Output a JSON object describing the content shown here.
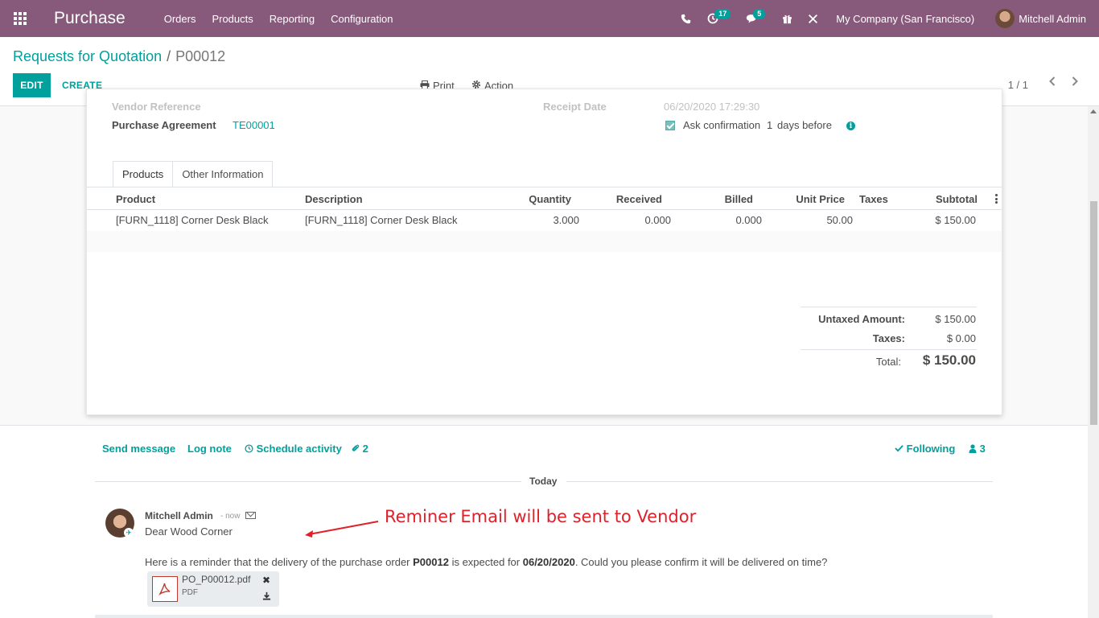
{
  "navbar": {
    "app_name": "Purchase",
    "menu": [
      "Orders",
      "Products",
      "Reporting",
      "Configuration"
    ],
    "activity_count": "17",
    "message_count": "5",
    "company": "My Company (San Francisco)",
    "user": "Mitchell Admin",
    "brand_color": "#875a7b"
  },
  "control": {
    "breadcrumb_parent": "Requests for Quotation",
    "breadcrumb_sep": "/",
    "breadcrumb_current": "P00012",
    "edit_label": "EDIT",
    "create_label": "CREATE",
    "print_label": "Print",
    "action_label": "Action",
    "pager": "1 / 1"
  },
  "form": {
    "vendor_reference_label": "Vendor Reference",
    "receipt_date_label": "Receipt Date",
    "receipt_date_value": "06/20/2020 17:29:30",
    "purchase_agreement_label": "Purchase Agreement",
    "purchase_agreement_value": "TE00001",
    "ask_confirmation_label": "Ask confirmation",
    "ask_confirmation_days": "1",
    "ask_confirmation_suffix": "days before",
    "ask_confirmation_checked": true
  },
  "tabs": [
    "Products",
    "Other Information"
  ],
  "table": {
    "headers": [
      "Product",
      "Description",
      "Quantity",
      "Received",
      "Billed",
      "Unit Price",
      "Taxes",
      "Subtotal"
    ],
    "rows": [
      {
        "product": "[FURN_1118] Corner Desk Black",
        "description": "[FURN_1118] Corner Desk Black",
        "quantity": "3.000",
        "received": "0.000",
        "billed": "0.000",
        "unit_price": "50.00",
        "taxes": "",
        "subtotal": "$ 150.00"
      }
    ]
  },
  "totals": {
    "untaxed_label": "Untaxed Amount:",
    "untaxed_value": "$ 150.00",
    "taxes_label": "Taxes:",
    "taxes_value": "$ 0.00",
    "total_label": "Total:",
    "total_value": "$ 150.00"
  },
  "chatter": {
    "send_message": "Send message",
    "log_note": "Log note",
    "schedule_activity": "Schedule activity",
    "attachments_count": "2",
    "following": "Following",
    "followers_count": "3",
    "day_label": "Today",
    "message": {
      "author": "Mitchell Admin",
      "time": "- now",
      "greeting": "Dear Wood Corner",
      "body_prefix": "Here is a reminder that the delivery of the purchase order ",
      "body_order": "P00012",
      "body_mid": " is expected for ",
      "body_date": "06/20/2020",
      "body_suffix": ". Could you please confirm it will be delivered on time?",
      "attachment_name": "PO_P00012.pdf",
      "attachment_type": "PDF"
    }
  },
  "annotation": {
    "text": "Reminer Email will be sent to Vendor",
    "color": "#e0202a"
  },
  "colors": {
    "accent": "#00a09d",
    "brand": "#875a7b"
  }
}
